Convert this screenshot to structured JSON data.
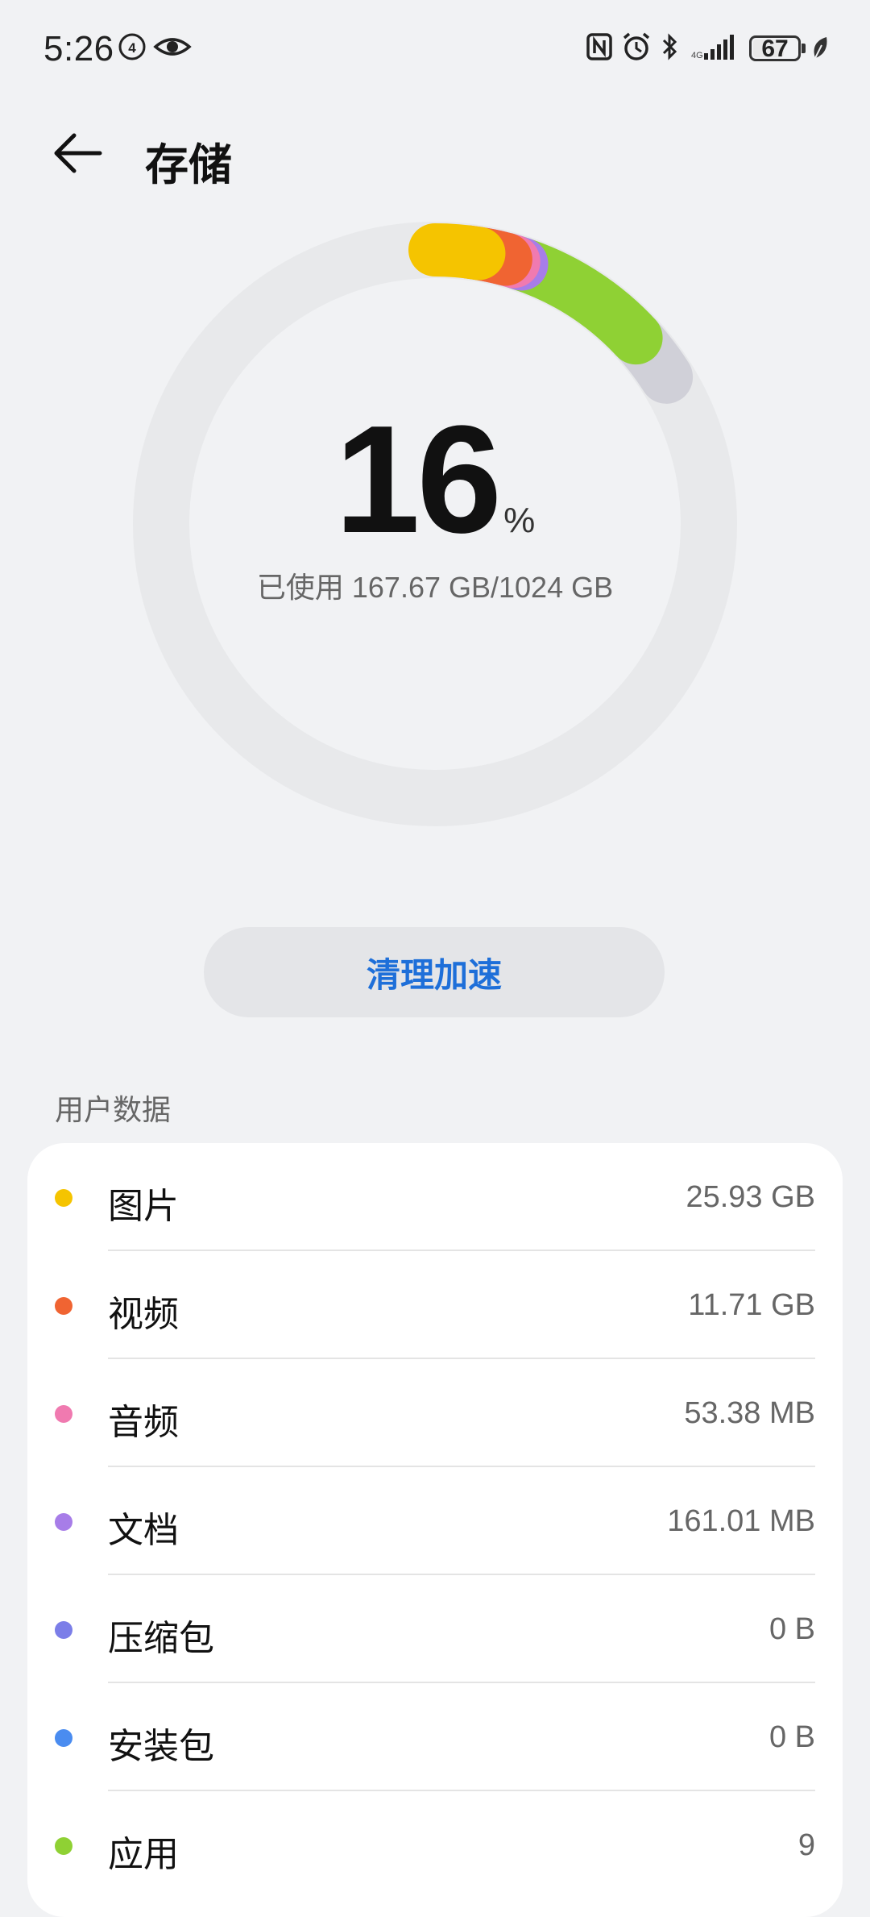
{
  "status_bar": {
    "time": "5:26",
    "battery_level": "67",
    "icons": [
      "hd-icon",
      "eye-icon",
      "nfc-icon",
      "alarm-icon",
      "bluetooth-icon",
      "signal-icon",
      "battery-icon",
      "leaf-icon"
    ]
  },
  "header": {
    "title": "存储",
    "back_icon": "arrow-left-icon"
  },
  "storage": {
    "percent": "16",
    "unit": "%",
    "used_text": "已使用 167.67 GB/1024 GB",
    "used_fraction": 0.16
  },
  "actions": {
    "clean_label": "清理加速"
  },
  "user_data": {
    "section_title": "用户数据",
    "items": [
      {
        "label": "图片",
        "value": "25.93 GB",
        "color": "#f5c400"
      },
      {
        "label": "视频",
        "value": "11.71 GB",
        "color": "#f06432"
      },
      {
        "label": "音频",
        "value": "53.38 MB",
        "color": "#f07ab0"
      },
      {
        "label": "文档",
        "value": "161.01 MB",
        "color": "#a77de8"
      },
      {
        "label": "压缩包",
        "value": "0 B",
        "color": "#7b7ee8"
      },
      {
        "label": "安装包",
        "value": "0 B",
        "color": "#4a8cf0"
      },
      {
        "label": "应用",
        "value": "9",
        "color": "#8fd134"
      }
    ]
  },
  "colors": {
    "accent": "#1e6fd9",
    "ring_track": "#e8e9eb",
    "ring_other": "#d0d0d8",
    "ring_apps": "#8fd134"
  }
}
